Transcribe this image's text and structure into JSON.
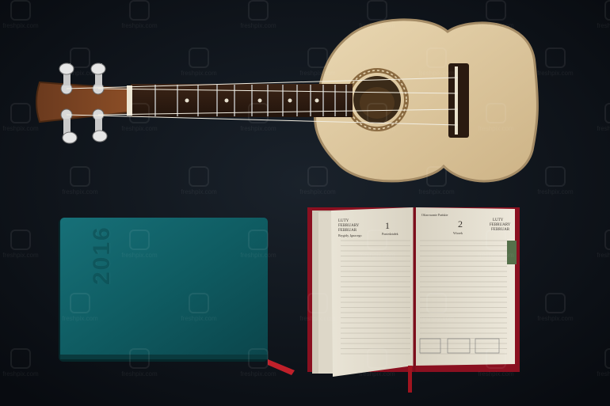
{
  "scene": {
    "background_color": "#0d1218",
    "objects": [
      "ukulele",
      "closed-green-diary",
      "open-diary"
    ]
  },
  "notebook_cover": {
    "year": "2016",
    "color": "#0f5a60"
  },
  "diary_left_page": {
    "month_lines": [
      "LUTY",
      "FEBRUARY",
      "FEBRUAR"
    ],
    "day_number": "1",
    "day_name": "Poniedziałek",
    "holiday": "Brygidy, Ignacego"
  },
  "diary_right_page": {
    "month_lines": [
      "LUTY",
      "FEBRUARY",
      "FEBRUAR"
    ],
    "day_number": "2",
    "holiday": "Ofiarowanie Pańskie",
    "day_name": "Wtorek"
  },
  "watermark_text": "freshpix.com",
  "colors": {
    "ukulele_body": "#e0c9a0",
    "diary_edge": "#8a1020",
    "bookmark": "#c0202a"
  }
}
